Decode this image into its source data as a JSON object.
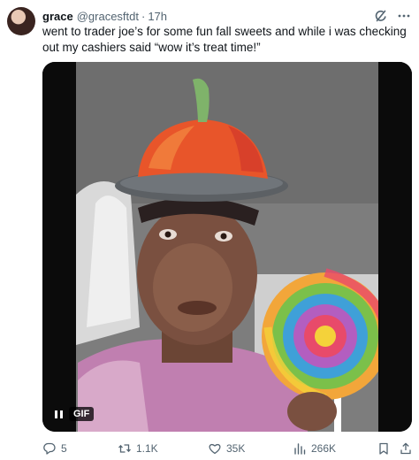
{
  "author": {
    "display_name": "grace",
    "handle": "@gracesftdt",
    "separator": "·",
    "time": "17h"
  },
  "header_icons": {
    "grok": "grok-icon",
    "more": "more-icon"
  },
  "tweet": {
    "text": "went to trader joe’s for some fun fall sweets and while i was checking out my cashiers said “wow it’s treat time!”"
  },
  "media": {
    "type": "gif",
    "badge_label": "GIF",
    "control_icon": "pause-icon"
  },
  "actions": {
    "reply_count": "5",
    "retweet_count": "1.1K",
    "like_count": "35K",
    "view_count": "266K",
    "icons": [
      "reply-icon",
      "retweet-icon",
      "like-icon",
      "views-icon",
      "bookmark-icon",
      "share-icon"
    ]
  },
  "colors": {
    "text_primary": "#0f1419",
    "text_secondary": "#536471",
    "background": "#ffffff"
  }
}
